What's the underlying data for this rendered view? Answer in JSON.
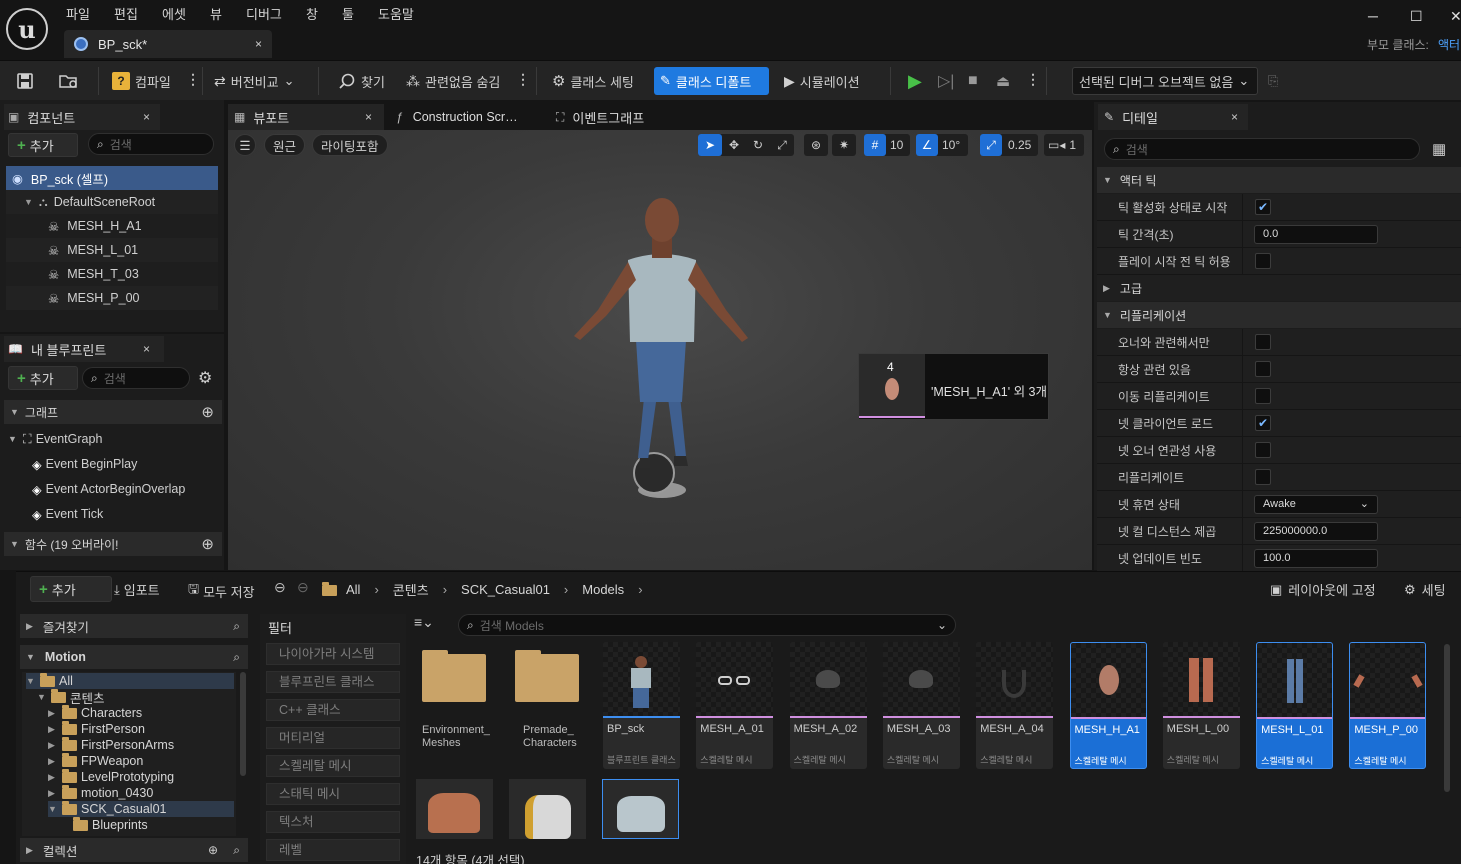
{
  "menu": [
    "파일",
    "편집",
    "에셋",
    "뷰",
    "디버그",
    "창",
    "툴",
    "도움말"
  ],
  "doc_tab": {
    "title": "BP_sck*",
    "close": "×"
  },
  "window": {
    "parent_class_label": "부모 클래스:",
    "parent_class_value": "액터",
    "minimize": "─",
    "maximize": "☐",
    "close": "✕"
  },
  "toolbar": {
    "compile": "컴파일",
    "diff": "버전비교",
    "find": "찾기",
    "hide_unrelated": "관련없음 숨김",
    "class_settings": "클래스 세팅",
    "class_defaults": "클래스 디폴트",
    "simulation": "시뮬레이션",
    "debug_object": "선택된 디버그 오브젝트 없음"
  },
  "components": {
    "tab": "컴포넌트",
    "add": "추가",
    "search_placeholder": "검색",
    "items": [
      {
        "label": "BP_sck (셀프)"
      },
      {
        "label": "DefaultSceneRoot"
      },
      {
        "label": "MESH_H_A1"
      },
      {
        "label": "MESH_L_01"
      },
      {
        "label": "MESH_T_03"
      },
      {
        "label": "MESH_P_00"
      }
    ]
  },
  "my_blueprint": {
    "tab": "내 블루프린트",
    "add": "추가",
    "search_placeholder": "검색",
    "graphs_header": "그래프",
    "event_graph": "EventGraph",
    "events": [
      "Event BeginPlay",
      "Event ActorBeginOverlap",
      "Event Tick"
    ],
    "functions_header": "함수 (19 오버라이!"
  },
  "center_tabs": {
    "viewport": "뷰포트",
    "construction": "Construction Scr…",
    "event_graph": "이벤트그래프"
  },
  "viewport": {
    "perspective": "원근",
    "lit": "라이팅포함",
    "grid_snap": "10",
    "rot_snap": "10°",
    "scale_snap": "0.25",
    "camera_speed": "1",
    "drag_count": "4",
    "drag_label": "'MESH_H_A1' 외 3개"
  },
  "details": {
    "tab": "디테일",
    "search_placeholder": "검색",
    "categories": {
      "actor_tick": "액터 틱",
      "advanced": "고급",
      "replication": "리플리케이션"
    },
    "tick_props": [
      {
        "label": "틱 활성화 상태로 시작",
        "type": "check",
        "checked": true
      },
      {
        "label": "틱 간격(초)",
        "type": "value",
        "value": "0.0"
      },
      {
        "label": "플레이 시작 전 틱 허용",
        "type": "check",
        "checked": false
      }
    ],
    "replication_props": [
      {
        "label": "오너와 관련해서만",
        "type": "check",
        "checked": false
      },
      {
        "label": "항상 관련 있음",
        "type": "check",
        "checked": false
      },
      {
        "label": "이동 리플리케이트",
        "type": "check",
        "checked": false
      },
      {
        "label": "넷 클라이언트 로드",
        "type": "check",
        "checked": true
      },
      {
        "label": "넷 오너 연관성 사용",
        "type": "check",
        "checked": false
      },
      {
        "label": "리플리케이트",
        "type": "check",
        "checked": false
      },
      {
        "label": "넷 휴면 상태",
        "type": "select",
        "value": "Awake"
      },
      {
        "label": "넷 컬 디스턴스 제곱",
        "type": "value",
        "value": "225000000.0"
      },
      {
        "label": "넷 업데이트 빈도",
        "type": "value",
        "value": "100.0"
      }
    ]
  },
  "content_browser": {
    "add": "추가",
    "import": "임포트",
    "save_all": "모두 저장",
    "breadcrumb": [
      "All",
      "콘텐츠",
      "SCK_Casual01",
      "Models"
    ],
    "lock_layout": "레이아웃에 고정",
    "settings": "세팅",
    "favorites": "즐겨찾기",
    "motion": "Motion",
    "collections": "컬렉션",
    "folders": [
      {
        "label": "All",
        "depth": 0
      },
      {
        "label": "콘텐츠",
        "depth": 1
      },
      {
        "label": "Characters",
        "depth": 2
      },
      {
        "label": "FirstPerson",
        "depth": 2
      },
      {
        "label": "FirstPersonArms",
        "depth": 2
      },
      {
        "label": "FPWeapon",
        "depth": 2
      },
      {
        "label": "LevelPrototyping",
        "depth": 2
      },
      {
        "label": "motion_0430",
        "depth": 2
      },
      {
        "label": "SCK_Casual01",
        "depth": 2
      },
      {
        "label": "Blueprints",
        "depth": 3
      }
    ],
    "filter_header": "필터",
    "filters": [
      "나이아가라 시스템",
      "블루프린트 클래스",
      "C++ 클래스",
      "머티리얼",
      "스켈레탈 메시",
      "스태틱 메시",
      "텍스처",
      "레벨"
    ],
    "search_placeholder": "검색 Models",
    "folder_assets": [
      {
        "line1": "Environment_",
        "line2": "Meshes"
      },
      {
        "line1": "Premade_",
        "line2": "Characters"
      }
    ],
    "assets": [
      {
        "name": "BP_sck",
        "type": "블루프린트 클래스",
        "selected": false,
        "icon": "character-figure-icon"
      },
      {
        "name": "MESH_A_01",
        "type": "스켈레탈 메시",
        "selected": false,
        "icon": "glasses-icon"
      },
      {
        "name": "MESH_A_02",
        "type": "스켈레탈 메시",
        "selected": false,
        "icon": "hair-icon"
      },
      {
        "name": "MESH_A_03",
        "type": "스켈레탈 메시",
        "selected": false,
        "icon": "hair-icon"
      },
      {
        "name": "MESH_A_04",
        "type": "스켈레탈 메시",
        "selected": false,
        "icon": "beard-icon"
      },
      {
        "name": "MESH_H_A1",
        "type": "스켈레탈 메시",
        "selected": true,
        "icon": "head-icon"
      },
      {
        "name": "MESH_L_00",
        "type": "스켈레탈 메시",
        "selected": false,
        "icon": "legs-icon"
      },
      {
        "name": "MESH_L_01",
        "type": "스켈레탈 메시",
        "selected": true,
        "icon": "jeans-icon"
      },
      {
        "name": "MESH_P_00",
        "type": "스켈레탈 메시",
        "selected": true,
        "icon": "hands-icon"
      }
    ],
    "status": "14개 항목 (4개 선택)"
  }
}
